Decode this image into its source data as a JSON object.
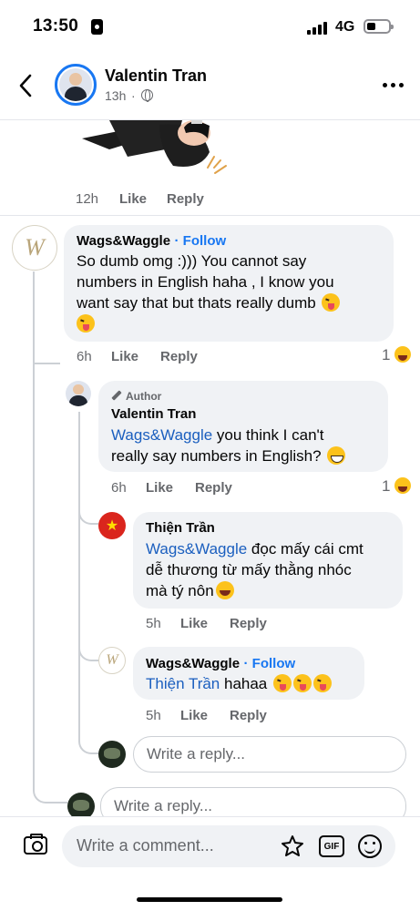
{
  "status_bar": {
    "time": "13:50",
    "network": "4G"
  },
  "header": {
    "name": "Valentin Tran",
    "time": "13h"
  },
  "prev_comment": {
    "time": "12h",
    "like": "Like",
    "reply": "Reply"
  },
  "comments": {
    "c1": {
      "author": "Wags&Waggle",
      "follow": "· Follow",
      "text_line1": "So dumb omg :))) You cannot say",
      "text_line2": "numbers in English haha , I know you",
      "text_line3": "want say that but thats really dumb",
      "time": "6h",
      "like": "Like",
      "reply": "Reply",
      "reactions": "1"
    },
    "c2": {
      "badge": "Author",
      "author": "Valentin Tran",
      "mention": "Wags&Waggle",
      "text_line1": " you think I can't",
      "text_line2": "really say numbers in English?",
      "time": "6h",
      "like": "Like",
      "reply": "Reply",
      "reactions": "1"
    },
    "c3": {
      "author": "Thiện Trần",
      "mention": "Wags&Waggle",
      "text_line1": " đọc mấy cái cmt",
      "text_line2": "dễ thương từ mấy thằng nhóc",
      "text_line3": "mà tý nôn",
      "time": "5h",
      "like": "Like",
      "reply": "Reply"
    },
    "c4": {
      "author": "Wags&Waggle",
      "follow": "· Follow",
      "mention": "Thiện Trần",
      "text": " hahaa",
      "time": "5h",
      "like": "Like",
      "reply": "Reply"
    }
  },
  "reply_placeholder": "Write a reply...",
  "comment_placeholder": "Write a comment...",
  "icons": {
    "back": "chevron-left-icon",
    "more": "more-dots-icon",
    "camera": "camera-icon",
    "sticker": "sticker-icon",
    "gif": "GIF",
    "emoji": "emoji-icon"
  },
  "colors": {
    "accent": "#1877f2",
    "bubble": "#f0f2f5",
    "meta": "#65676b"
  }
}
